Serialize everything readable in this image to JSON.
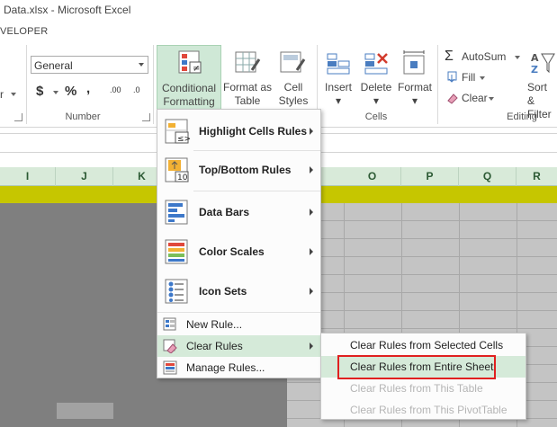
{
  "window": {
    "title": "Data.xlsx - Microsoft Excel"
  },
  "tabs": {
    "visible_tab": "VELOPER"
  },
  "ribbon": {
    "alignment_fragment": "r",
    "number": {
      "format_value": "General",
      "currency_symbol": "$",
      "percent_symbol": "%",
      "comma_symbol": ",",
      "increase_decimal": ".00",
      "decrease_decimal": ".0",
      "group_label": "Number"
    },
    "styles": {
      "conditional_formatting": [
        "Conditional",
        "Formatting"
      ],
      "format_as_table": [
        "Format as",
        "Table"
      ],
      "cell_styles": [
        "Cell",
        "Styles"
      ]
    },
    "cells": {
      "insert": "Insert",
      "delete": "Delete",
      "format": "Format",
      "group_label": "Cells"
    },
    "editing": {
      "autosum": "AutoSum",
      "fill": "Fill",
      "clear": "Clear",
      "sort_filter": [
        "Sort &",
        "Filter"
      ],
      "group_label": "Editing"
    }
  },
  "sheet": {
    "columns": [
      "I",
      "J",
      "K",
      "O",
      "P",
      "Q",
      "R"
    ]
  },
  "menu": {
    "items": [
      {
        "label": "Highlight Cells Rules",
        "icon": "highlight-cells-icon"
      },
      {
        "label": "Top/Bottom Rules",
        "icon": "top-bottom-icon"
      },
      {
        "label": "Data Bars",
        "icon": "data-bars-icon"
      },
      {
        "label": "Color Scales",
        "icon": "color-scales-icon"
      },
      {
        "label": "Icon Sets",
        "icon": "icon-sets-icon"
      },
      {
        "label": "New Rule...",
        "icon": "new-rule-icon"
      },
      {
        "label": "Clear Rules",
        "icon": "clear-rules-icon"
      },
      {
        "label": "Manage Rules...",
        "icon": "manage-rules-icon"
      }
    ]
  },
  "submenu": {
    "items": [
      {
        "label": "Clear Rules from Selected Cells",
        "enabled": true
      },
      {
        "label": "Clear Rules from Entire Sheet",
        "enabled": true
      },
      {
        "label": "Clear Rules from This Table",
        "enabled": false
      },
      {
        "label": "Clear Rules from This PivotTable",
        "enabled": false
      }
    ]
  },
  "colors": {
    "accent_green": "#217346",
    "hover_bg": "#d5ead9",
    "highlight_row": "#c6c600",
    "annotation_red": "#e02020"
  }
}
